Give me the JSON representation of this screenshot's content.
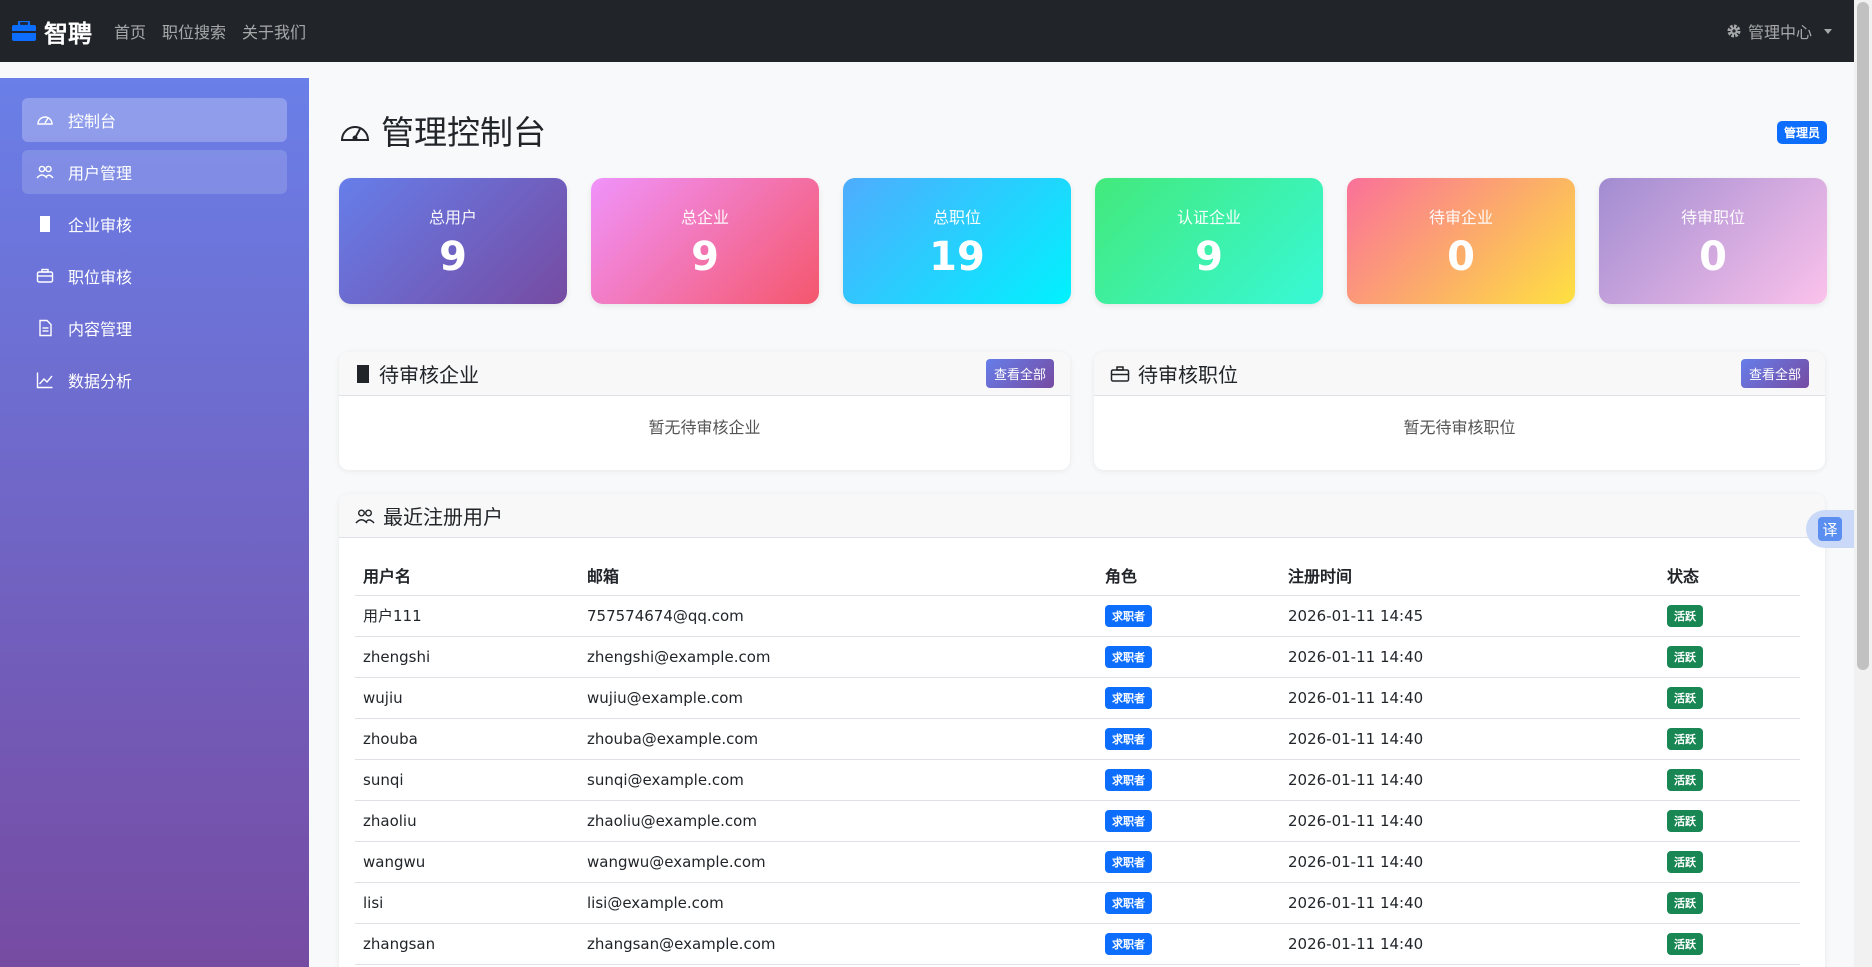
{
  "navbar": {
    "brand": "智聘",
    "links": [
      "首页",
      "职位搜索",
      "关于我们"
    ],
    "admin_menu": "管理中心"
  },
  "sidebar": {
    "items": [
      {
        "label": "控制台",
        "icon": "speedometer-icon",
        "state": "active"
      },
      {
        "label": "用户管理",
        "icon": "people-icon",
        "state": "hover"
      },
      {
        "label": "企业审核",
        "icon": "building-icon",
        "state": ""
      },
      {
        "label": "职位审核",
        "icon": "briefcase-icon",
        "state": ""
      },
      {
        "label": "内容管理",
        "icon": "file-text-icon",
        "state": ""
      },
      {
        "label": "数据分析",
        "icon": "graph-icon",
        "state": ""
      }
    ]
  },
  "page": {
    "title": "管理控制台",
    "role_badge": "管理员"
  },
  "stats": [
    {
      "label": "总用户",
      "value": "9",
      "gradient": [
        "#667eea",
        "#764ba2"
      ]
    },
    {
      "label": "总企业",
      "value": "9",
      "gradient": [
        "#f093fb",
        "#f5576c"
      ]
    },
    {
      "label": "总职位",
      "value": "19",
      "gradient": [
        "#4facfe",
        "#00f2fe"
      ]
    },
    {
      "label": "认证企业",
      "value": "9",
      "gradient": [
        "#43e97b",
        "#38f9d7"
      ]
    },
    {
      "label": "待审企业",
      "value": "0",
      "gradient": [
        "#fa709a",
        "#fee140"
      ]
    },
    {
      "label": "待审职位",
      "value": "0",
      "gradient": [
        "#a18cd1",
        "#fbc2eb"
      ]
    }
  ],
  "pending_companies": {
    "title": "待审核企业",
    "button": "查看全部",
    "empty": "暂无待审核企业"
  },
  "pending_jobs": {
    "title": "待审核职位",
    "button": "查看全部",
    "empty": "暂无待审核职位"
  },
  "recent_users": {
    "title": "最近注册用户",
    "columns": [
      "用户名",
      "邮箱",
      "角色",
      "注册时间",
      "状态"
    ],
    "rows": [
      {
        "username": "用户111",
        "email": "757574674@qq.com",
        "role": "求职者",
        "time": "2026-01-11 14:45",
        "status": "活跃"
      },
      {
        "username": "zhengshi",
        "email": "zhengshi@example.com",
        "role": "求职者",
        "time": "2026-01-11 14:40",
        "status": "活跃"
      },
      {
        "username": "wujiu",
        "email": "wujiu@example.com",
        "role": "求职者",
        "time": "2026-01-11 14:40",
        "status": "活跃"
      },
      {
        "username": "zhouba",
        "email": "zhouba@example.com",
        "role": "求职者",
        "time": "2026-01-11 14:40",
        "status": "活跃"
      },
      {
        "username": "sunqi",
        "email": "sunqi@example.com",
        "role": "求职者",
        "time": "2026-01-11 14:40",
        "status": "活跃"
      },
      {
        "username": "zhaoliu",
        "email": "zhaoliu@example.com",
        "role": "求职者",
        "time": "2026-01-11 14:40",
        "status": "活跃"
      },
      {
        "username": "wangwu",
        "email": "wangwu@example.com",
        "role": "求职者",
        "time": "2026-01-11 14:40",
        "status": "活跃"
      },
      {
        "username": "lisi",
        "email": "lisi@example.com",
        "role": "求职者",
        "time": "2026-01-11 14:40",
        "status": "活跃"
      },
      {
        "username": "zhangsan",
        "email": "zhangsan@example.com",
        "role": "求职者",
        "time": "2026-01-11 14:40",
        "status": "活跃"
      }
    ]
  },
  "translate_button": "译",
  "colors": {
    "navbar": "#212529",
    "primary": "#0d6efd",
    "success": "#198754",
    "sidebar_start": "#6a7fe8",
    "sidebar_end": "#764ba2"
  }
}
